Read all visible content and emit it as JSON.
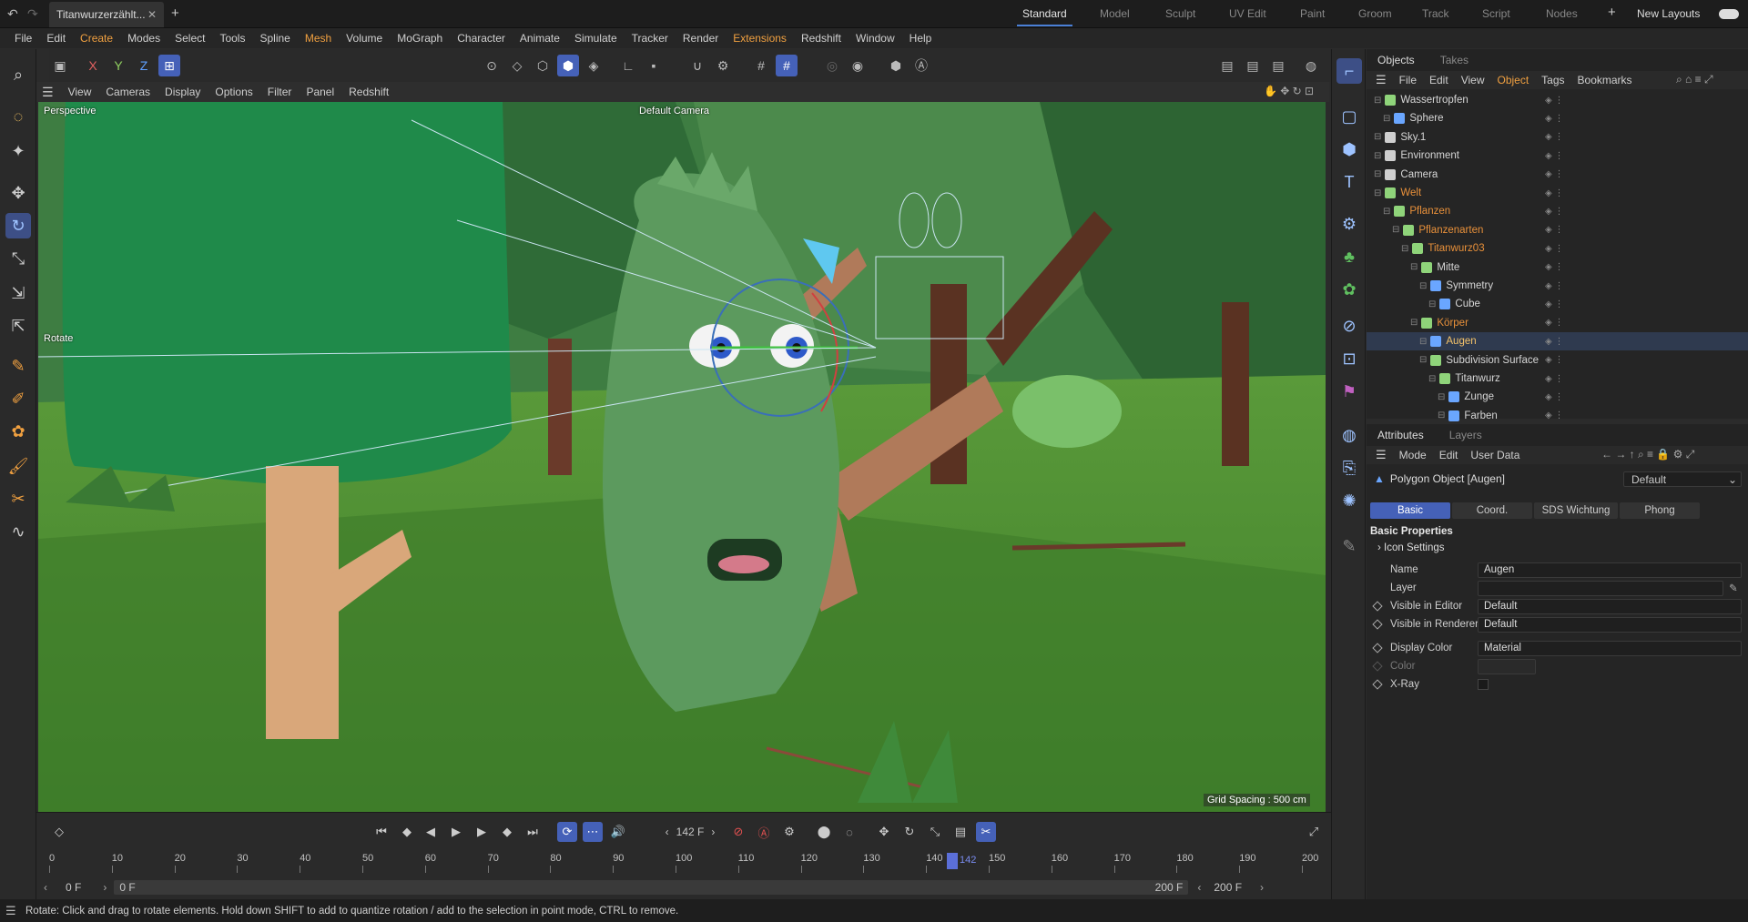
{
  "titlebar": {
    "doc_tab": "Titanwurzerzählt...",
    "layouts": [
      "Standard",
      "Model",
      "Sculpt",
      "UV Edit",
      "Paint",
      "Groom",
      "Track",
      "Script",
      "Nodes"
    ],
    "active_layout": "Standard",
    "new_layouts": "New Layouts"
  },
  "menu": [
    "File",
    "Edit",
    "Create",
    "Modes",
    "Select",
    "Tools",
    "Spline",
    "Mesh",
    "Volume",
    "MoGraph",
    "Character",
    "Animate",
    "Simulate",
    "Tracker",
    "Render",
    "Extensions",
    "Redshift",
    "Window",
    "Help"
  ],
  "menu_highlight": [
    "Create",
    "Mesh",
    "Extensions"
  ],
  "axes": {
    "x": "X",
    "y": "Y",
    "z": "Z"
  },
  "viewport_menu": [
    "View",
    "Cameras",
    "Display",
    "Options",
    "Filter",
    "Panel",
    "Redshift"
  ],
  "viewport": {
    "projection": "Perspective",
    "camera": "Default Camera",
    "tool_label": "Rotate",
    "grid_spacing": "Grid Spacing : 500 cm"
  },
  "objects_panel": {
    "tabs": [
      "Objects",
      "Takes"
    ],
    "menu": [
      "File",
      "Edit",
      "View",
      "Object",
      "Tags",
      "Bookmarks"
    ],
    "rows": [
      {
        "name": "Wassertropfen",
        "indent": 0,
        "style": "normal",
        "icon": "null-icon"
      },
      {
        "name": "Sphere",
        "indent": 1,
        "style": "normal",
        "icon": "polygon-icon"
      },
      {
        "name": "Sky.1",
        "indent": 0,
        "style": "normal",
        "icon": "sky-icon"
      },
      {
        "name": "Environment",
        "indent": 0,
        "style": "normal",
        "icon": "environment-icon"
      },
      {
        "name": "Camera",
        "indent": 0,
        "style": "normal",
        "icon": "camera-icon"
      },
      {
        "name": "Welt",
        "indent": 0,
        "style": "orange",
        "icon": "null-icon"
      },
      {
        "name": "Pflanzen",
        "indent": 1,
        "style": "orange",
        "icon": "null-icon"
      },
      {
        "name": "Pflanzenarten",
        "indent": 2,
        "style": "orange",
        "icon": "null-icon"
      },
      {
        "name": "Titanwurz03",
        "indent": 3,
        "style": "orange",
        "icon": "null-icon"
      },
      {
        "name": "Mitte",
        "indent": 4,
        "style": "normal",
        "icon": "null-icon"
      },
      {
        "name": "Symmetry",
        "indent": 5,
        "style": "normal",
        "icon": "symmetry-icon"
      },
      {
        "name": "Cube",
        "indent": 6,
        "style": "normal",
        "icon": "polygon-icon"
      },
      {
        "name": "Körper",
        "indent": 4,
        "style": "orange",
        "icon": "null-icon"
      },
      {
        "name": "Augen",
        "indent": 5,
        "style": "selected",
        "icon": "polygon-icon"
      },
      {
        "name": "Subdivision Surface",
        "indent": 5,
        "style": "normal",
        "icon": "subdivision-icon"
      },
      {
        "name": "Titanwurz",
        "indent": 6,
        "style": "normal",
        "icon": "null-icon"
      },
      {
        "name": "Zunge",
        "indent": 7,
        "style": "normal",
        "icon": "polygon-icon"
      },
      {
        "name": "Farben",
        "indent": 7,
        "style": "normal",
        "icon": "polygon-icon"
      }
    ]
  },
  "attributes_panel": {
    "tabs": [
      "Attributes",
      "Layers"
    ],
    "menu": [
      "Mode",
      "Edit",
      "User Data"
    ],
    "object_label": "Polygon Object [Augen]",
    "preset": "Default",
    "prop_tabs": [
      "Basic",
      "Coord.",
      "SDS Wichtung",
      "Phong"
    ],
    "active_prop_tab": "Basic",
    "section": "Basic Properties",
    "subsection": "Icon Settings",
    "fields": [
      {
        "label": "Name",
        "value": "Augen"
      },
      {
        "label": "Layer",
        "value": ""
      },
      {
        "label": "Visible in Editor",
        "value": "Default"
      },
      {
        "label": "Visible in Renderer",
        "value": "Default"
      },
      {
        "label": "Display Color",
        "value": "Material"
      },
      {
        "label": "Color",
        "value": ""
      },
      {
        "label": "X-Ray",
        "value": ""
      }
    ]
  },
  "timeline": {
    "current_frame": "142 F",
    "frame_marker": "142",
    "ticks": [
      "0",
      "10",
      "20",
      "30",
      "40",
      "50",
      "60",
      "70",
      "80",
      "90",
      "100",
      "110",
      "120",
      "130",
      "140",
      "150",
      "160",
      "170",
      "180",
      "190",
      "200"
    ],
    "start": "0 F",
    "range_start": "0 F",
    "range_end": "200 F",
    "end": "200 F"
  },
  "status": "Rotate: Click and drag to rotate elements. Hold down SHIFT to add to quantize rotation / add to the selection in point mode, CTRL to remove."
}
